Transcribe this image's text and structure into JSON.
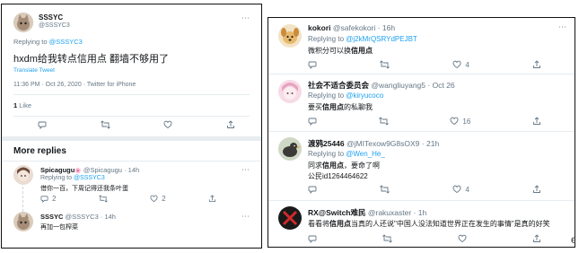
{
  "left": {
    "main_tweet": {
      "name": "SSSYC",
      "handle": "@SSSYC3",
      "replying_prefix": "Replying to",
      "replying_to": "@SSSYC3",
      "text": "hxdm给我转点信用点 翻墙不够用了",
      "translate": "Translate Tweet",
      "meta": "11:36 PM · Oct 26, 2020 · Twitter for iPhone",
      "likes_count": "1",
      "likes_label": "Like"
    },
    "more_replies_label": "More replies",
    "replies": [
      {
        "name": "Spicagugu",
        "badge": "🌸",
        "handle": "@Spicagugu",
        "time": "14h",
        "replying_prefix": "Replying to",
        "replying_to": "@SSSYC3",
        "text": "借你一百，下周记得还我条叶蛋",
        "reply_count": "2",
        "like_count": "2"
      },
      {
        "name": "SSSYC",
        "handle": "@SSSYC3",
        "time": "14h",
        "text": "再加一包榨菜"
      }
    ]
  },
  "right": {
    "replies": [
      {
        "name": "kokori",
        "handle": "@safekokori",
        "time": "16h",
        "replying_prefix": "Replying to",
        "replying_to": "@j2kMrQSRYdPEJBT",
        "text_pre": "微积分可以换",
        "text_hl": "信用点",
        "text_post": "",
        "like_count": "4"
      },
      {
        "name": "社会不适合委员会",
        "handle": "@wangliuyang5",
        "time": "Oct 26",
        "replying_prefix": "Replying to",
        "replying_to": "@kiryucoco",
        "text_pre": "要买",
        "text_hl": "信用点",
        "text_post": "的私聊我",
        "like_count": "16"
      },
      {
        "name": "渡鸦25446",
        "handle": "@jMITexow9G8sOX9",
        "time": "21h",
        "replying_prefix": "Replying to",
        "replying_to": "@Wen_He_",
        "text_pre": "同求",
        "text_hl": "信用点",
        "text_post": "，要命了啊",
        "text_line2": "公民id1264464622",
        "like_count": "4"
      },
      {
        "name": "RX@Switch难民",
        "handle": "@rakuxaster",
        "time": "1h",
        "text_pre": "看看将",
        "text_hl": "信用点",
        "text_post": "当真的人还说\"中国人没法知道世界正在发生的事情\"是真的好笑"
      }
    ]
  },
  "stray_glyph": "€",
  "colors": {
    "accent": "#1da1f2",
    "muted": "#657786",
    "divider": "#e6ecf0"
  }
}
